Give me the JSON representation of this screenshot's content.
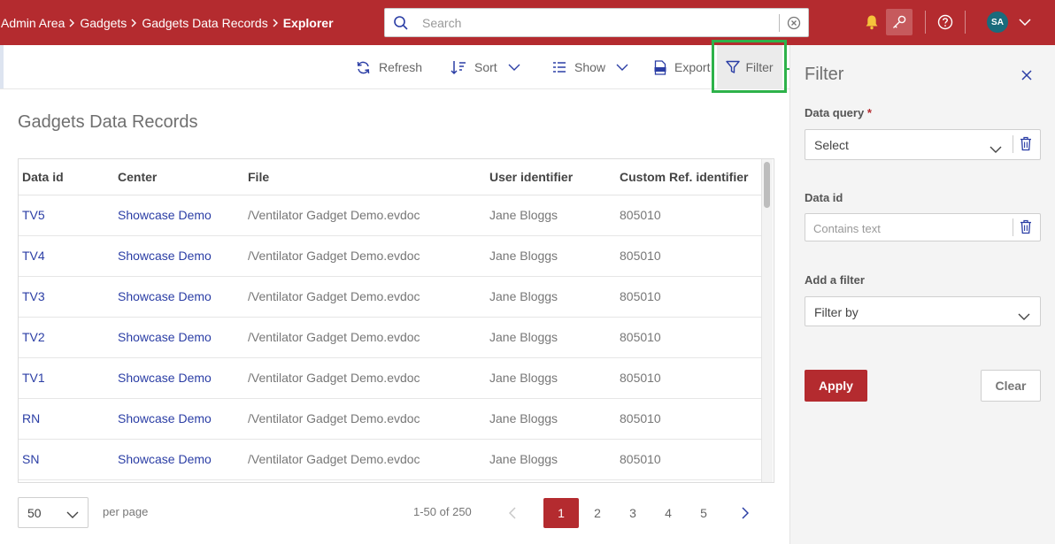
{
  "colors": {
    "brand": "#b42b2f",
    "link": "#2b3ea5",
    "highlight": "#2eb24a",
    "avatar": "#1a6b7c"
  },
  "breadcrumb": [
    "Admin Area",
    "Gadgets",
    "Gadgets Data Records",
    "Explorer"
  ],
  "search": {
    "placeholder": "Search"
  },
  "user": {
    "initials": "SA"
  },
  "toolbar": {
    "refresh": "Refresh",
    "sort": "Sort",
    "show": "Show",
    "export": "Export",
    "filter": "Filter"
  },
  "page": {
    "title": "Gadgets Data Records"
  },
  "table": {
    "headers": [
      "Data id",
      "Center",
      "File",
      "User identifier",
      "Custom Ref. identifier"
    ],
    "rows": [
      [
        "TV5",
        "Showcase Demo",
        "/Ventilator Gadget Demo.evdoc",
        "Jane Bloggs",
        "805010"
      ],
      [
        "TV4",
        "Showcase Demo",
        "/Ventilator Gadget Demo.evdoc",
        "Jane Bloggs",
        "805010"
      ],
      [
        "TV3",
        "Showcase Demo",
        "/Ventilator Gadget Demo.evdoc",
        "Jane Bloggs",
        "805010"
      ],
      [
        "TV2",
        "Showcase Demo",
        "/Ventilator Gadget Demo.evdoc",
        "Jane Bloggs",
        "805010"
      ],
      [
        "TV1",
        "Showcase Demo",
        "/Ventilator Gadget Demo.evdoc",
        "Jane Bloggs",
        "805010"
      ],
      [
        "RN",
        "Showcase Demo",
        "/Ventilator Gadget Demo.evdoc",
        "Jane Bloggs",
        "805010"
      ],
      [
        "SN",
        "Showcase Demo",
        "/Ventilator Gadget Demo.evdoc",
        "Jane Bloggs",
        "805010"
      ]
    ]
  },
  "pagination": {
    "per_page": "50",
    "per_page_label": "per page",
    "range": "1-50 of 250",
    "pages": [
      "1",
      "2",
      "3",
      "4",
      "5"
    ],
    "current": "1"
  },
  "filter_panel": {
    "title": "Filter",
    "data_query_label": "Data query",
    "required_mark": "*",
    "data_query_value": "Select",
    "data_id_label": "Data id",
    "data_id_placeholder": "Contains text",
    "add_filter_label": "Add a filter",
    "add_filter_value": "Filter by",
    "apply": "Apply",
    "clear": "Clear"
  }
}
